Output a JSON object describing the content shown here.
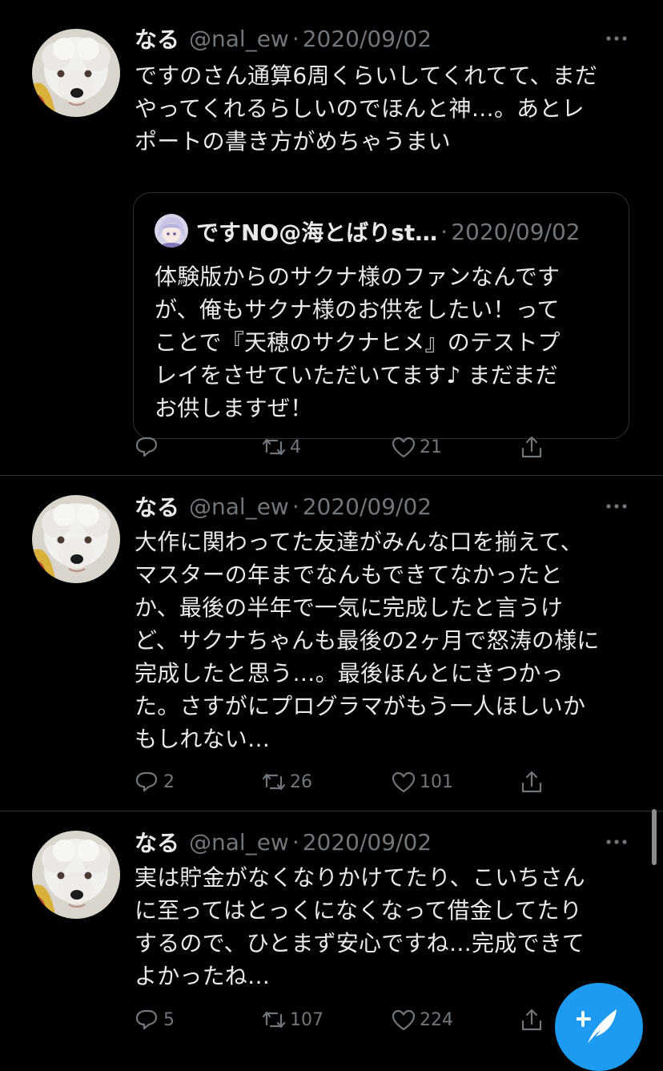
{
  "tweets": [
    {
      "name": "なる",
      "handle": "@nal_ew",
      "separator": "·",
      "date": "2020/09/02",
      "text": "ですのさん通算6周くらいしてくれてて、まだ\nやってくれるらしいのでほんと神…。あとレ\nポートの書き方がめちゃうまい",
      "quote": {
        "name": "ですNO@海とばりst…",
        "separator": "·",
        "date": "2020/09/02",
        "text": "体験版からのサクナ様のファンなんです\nが、俺もサクナ様のお供をしたい！って\nことで『天穂のサクナヒメ』のテストプ\nレイをさせていただいてます♪ まだまだ\nお供しますぜ！"
      },
      "actions": {
        "replies": "",
        "retweets": "4",
        "likes": "21"
      }
    },
    {
      "name": "なる",
      "handle": "@nal_ew",
      "separator": "·",
      "date": "2020/09/02",
      "text": "大作に関わってた友達がみんな口を揃えて、\nマスターの年までなんもできてなかったと\nか、最後の半年で一気に完成したと言うけ\nど、サクナちゃんも最後の2ヶ月で怒涛の様に\n完成したと思う…。最後ほんとにきつかっ\nた。さすがにプログラマがもう一人ほしいか\nもしれない…",
      "actions": {
        "replies": "2",
        "retweets": "26",
        "likes": "101"
      }
    },
    {
      "name": "なる",
      "handle": "@nal_ew",
      "separator": "·",
      "date": "2020/09/02",
      "text": "実は貯金がなくなりかけてたり、こいちさん\nに至ってはとっくになくなって借金してたり\nするので、ひとまず安心ですね…完成できて\nよかったね…",
      "actions": {
        "replies": "5",
        "retweets": "107",
        "likes": "224"
      }
    }
  ],
  "icons": {
    "more": "more-icon",
    "reply": "reply-icon",
    "retweet": "retweet-icon",
    "like": "like-icon",
    "share": "share-icon",
    "compose": "compose-tweet-icon"
  },
  "colors": {
    "background": "#000000",
    "text": "#e7e9ea",
    "secondary": "#71767b",
    "divider": "#2f3336",
    "accent": "#1d9bf0"
  }
}
